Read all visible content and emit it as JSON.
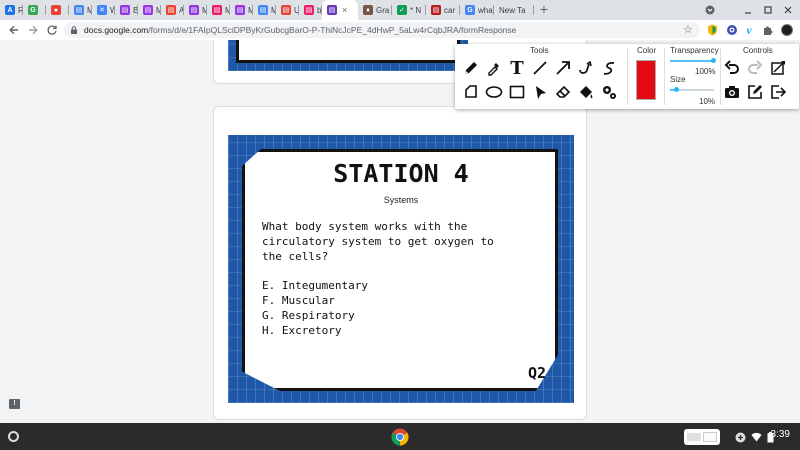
{
  "browser": {
    "tabs": [
      {
        "label": "Rec",
        "color": "#1a73e8",
        "glyph": "A"
      },
      {
        "label": "",
        "color": "#34a853",
        "glyph": "G"
      },
      {
        "label": "",
        "color": "#ea4335",
        "glyph": "●"
      },
      {
        "label": "Ma",
        "color": "#4285f4",
        "glyph": "▤"
      },
      {
        "label": "Wh",
        "color": "#4285f4",
        "glyph": "✕"
      },
      {
        "label": "Boc",
        "color": "#9334e6",
        "glyph": "▤"
      },
      {
        "label": "Mo",
        "color": "#9334e6",
        "glyph": "▤"
      },
      {
        "label": "Ans",
        "color": "#ea4335",
        "glyph": "▤"
      },
      {
        "label": "Ma",
        "color": "#9334e6",
        "glyph": "▤"
      },
      {
        "label": "Mo",
        "color": "#e91e63",
        "glyph": "▤"
      },
      {
        "label": "Ma",
        "color": "#9334e6",
        "glyph": "▤"
      },
      {
        "label": "Ma",
        "color": "#4285f4",
        "glyph": "▤"
      },
      {
        "label": "Uta",
        "color": "#ea4335",
        "glyph": "▤"
      },
      {
        "label": "bro",
        "color": "#e91e63",
        "glyph": "▤"
      }
    ],
    "active_tab": {
      "label": "",
      "color": "#673ab7",
      "close": "×"
    },
    "tabs_after": [
      {
        "label": "Gra",
        "color": "#795548",
        "glyph": "♦"
      },
      {
        "label": "* N",
        "color": "#0f9d58",
        "glyph": "✓"
      },
      {
        "label": "car",
        "color": "#b71c1c",
        "glyph": "▤"
      },
      {
        "label": "wha",
        "color": "#4285f4",
        "glyph": "G"
      },
      {
        "label": "New Ta",
        "color": "",
        "glyph": ""
      }
    ],
    "new_tab_symbol": "+",
    "url_host": "docs.google.com",
    "url_path": "/forms/d/e/1FAIpQLSciDPByKrGubcgBarO-P-ThiNcJcPE_4dHwP_5aLw4rCqbJRA/formResponse"
  },
  "annotation_toolbar": {
    "tools_title": "Tools",
    "color_title": "Color",
    "transparency_title": "Transparency",
    "transparency_value": "100%",
    "transparency_level": 1.0,
    "size_title": "Size",
    "size_value": "10%",
    "size_level": 0.1,
    "controls_title": "Controls",
    "selected_color": "#e50914"
  },
  "slide": {
    "title": "STATION 4",
    "subtitle": "Systems",
    "question_lines": [
      "What body system works with the",
      "circulatory system to get oxygen to",
      "the cells?"
    ],
    "answers": [
      "E. Integumentary",
      "F. Muscular",
      "G. Respiratory",
      "H. Excretory"
    ],
    "question_number": "Q2"
  },
  "shelf": {
    "clock": "3:39"
  }
}
